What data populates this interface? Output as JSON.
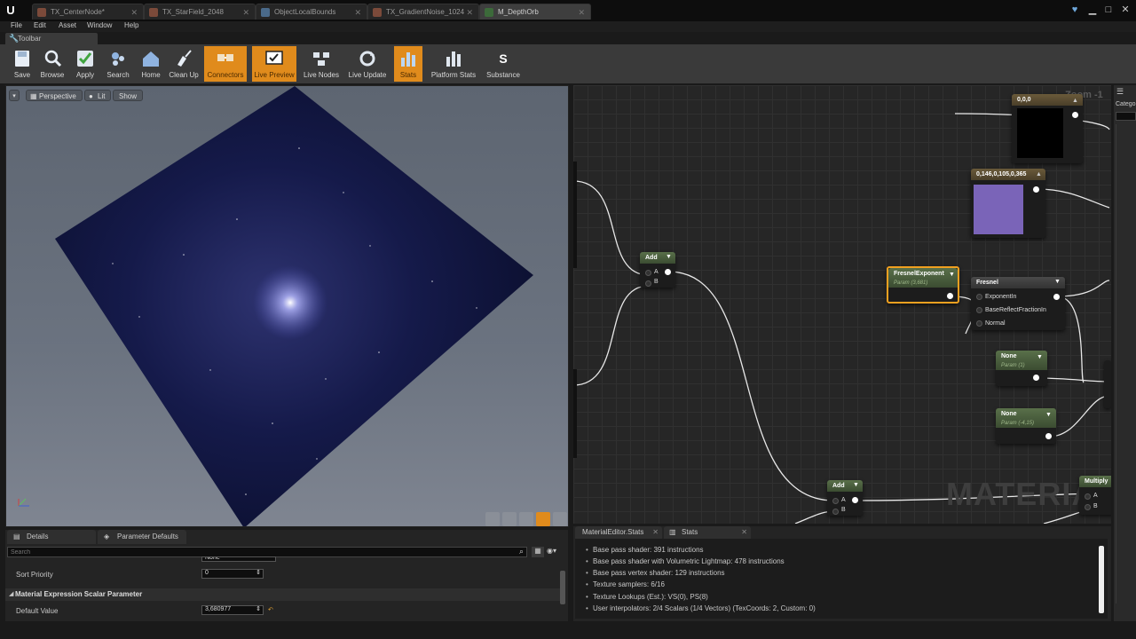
{
  "app": {
    "logo_glyph": "U"
  },
  "tabs": [
    {
      "label": "TX_CenterNode*"
    },
    {
      "label": "TX_StarField_2048"
    },
    {
      "label": "ObjectLocalBounds"
    },
    {
      "label": "TX_GradientNoise_1024"
    },
    {
      "label": "M_DepthOrb"
    }
  ],
  "menu": [
    "File",
    "Edit",
    "Asset",
    "Window",
    "Help"
  ],
  "toolbar_header": "Toolbar",
  "toolbar": [
    {
      "label": "Save",
      "icon": "save-icon",
      "active": false
    },
    {
      "label": "Browse",
      "icon": "browse-icon",
      "active": false
    },
    {
      "label": "Apply",
      "icon": "apply-icon",
      "active": false
    },
    {
      "label": "Search",
      "icon": "search-icon",
      "active": false
    },
    {
      "label": "Home",
      "icon": "home-icon",
      "active": false
    },
    {
      "label": "Clean Up",
      "icon": "broom-icon",
      "active": false
    },
    {
      "label": "Connectors",
      "icon": "connectors-icon",
      "active": true
    },
    {
      "label": "Live Preview",
      "icon": "live-preview-icon",
      "active": true
    },
    {
      "label": "Live Nodes",
      "icon": "live-nodes-icon",
      "active": false
    },
    {
      "label": "Live Update",
      "icon": "live-update-icon",
      "active": false
    },
    {
      "label": "Stats",
      "icon": "stats-icon",
      "active": true
    },
    {
      "label": "Platform Stats",
      "icon": "platform-stats-icon",
      "active": false
    },
    {
      "label": "Substance",
      "icon": "substance-icon",
      "active": false
    }
  ],
  "viewport": {
    "perspective": "Perspective",
    "lit": "Lit",
    "show": "Show"
  },
  "details": {
    "tabs": [
      "Details",
      "Parameter Defaults"
    ],
    "search_placeholder": "Search",
    "group_value": "None",
    "sort_priority_label": "Sort Priority",
    "sort_priority_value": "0",
    "section_title": "Material Expression Scalar Parameter",
    "default_value_label": "Default Value",
    "default_value": "3,680977"
  },
  "graph": {
    "zoom": "Zoom -1",
    "watermark": "MATERIAL",
    "nodes": {
      "const_black": {
        "title": "0,0,0"
      },
      "const_purple": {
        "title": "0,146,0,105,0,365",
        "color": "#7a64b8"
      },
      "add_top": {
        "title": "Add",
        "pin_a": "A",
        "pin_b": "B"
      },
      "fresnel_exp": {
        "title": "FresnelExponent",
        "sub": "Param (3,681)"
      },
      "fresnel": {
        "title": "Fresnel",
        "inputs": [
          "ExponentIn",
          "BaseReflectFractionIn",
          "Normal"
        ]
      },
      "none1": {
        "title": "None",
        "sub": "Param (1)"
      },
      "none2": {
        "title": "None",
        "sub": "Param (-4,15)"
      },
      "add_bottom": {
        "title": "Add",
        "pin_a": "A",
        "pin_b": "B"
      },
      "multiply": {
        "title": "Multiply",
        "pin_a": "A",
        "pin_b": "B"
      }
    }
  },
  "stats": {
    "tabs": [
      "MaterialEditor.Stats",
      "Stats"
    ],
    "lines": [
      "Base pass shader: 391 instructions",
      "Base pass shader with Volumetric Lightmap: 478 instructions",
      "Base pass vertex shader: 129 instructions",
      "Texture samplers: 6/16",
      "Texture Lookups (Est.): VS(0), PS(8)",
      "User interpolators: 2/4 Scalars (1/4 Vectors) (TexCoords: 2, Custom: 0)"
    ]
  },
  "right_panel": {
    "label": "Catego"
  }
}
